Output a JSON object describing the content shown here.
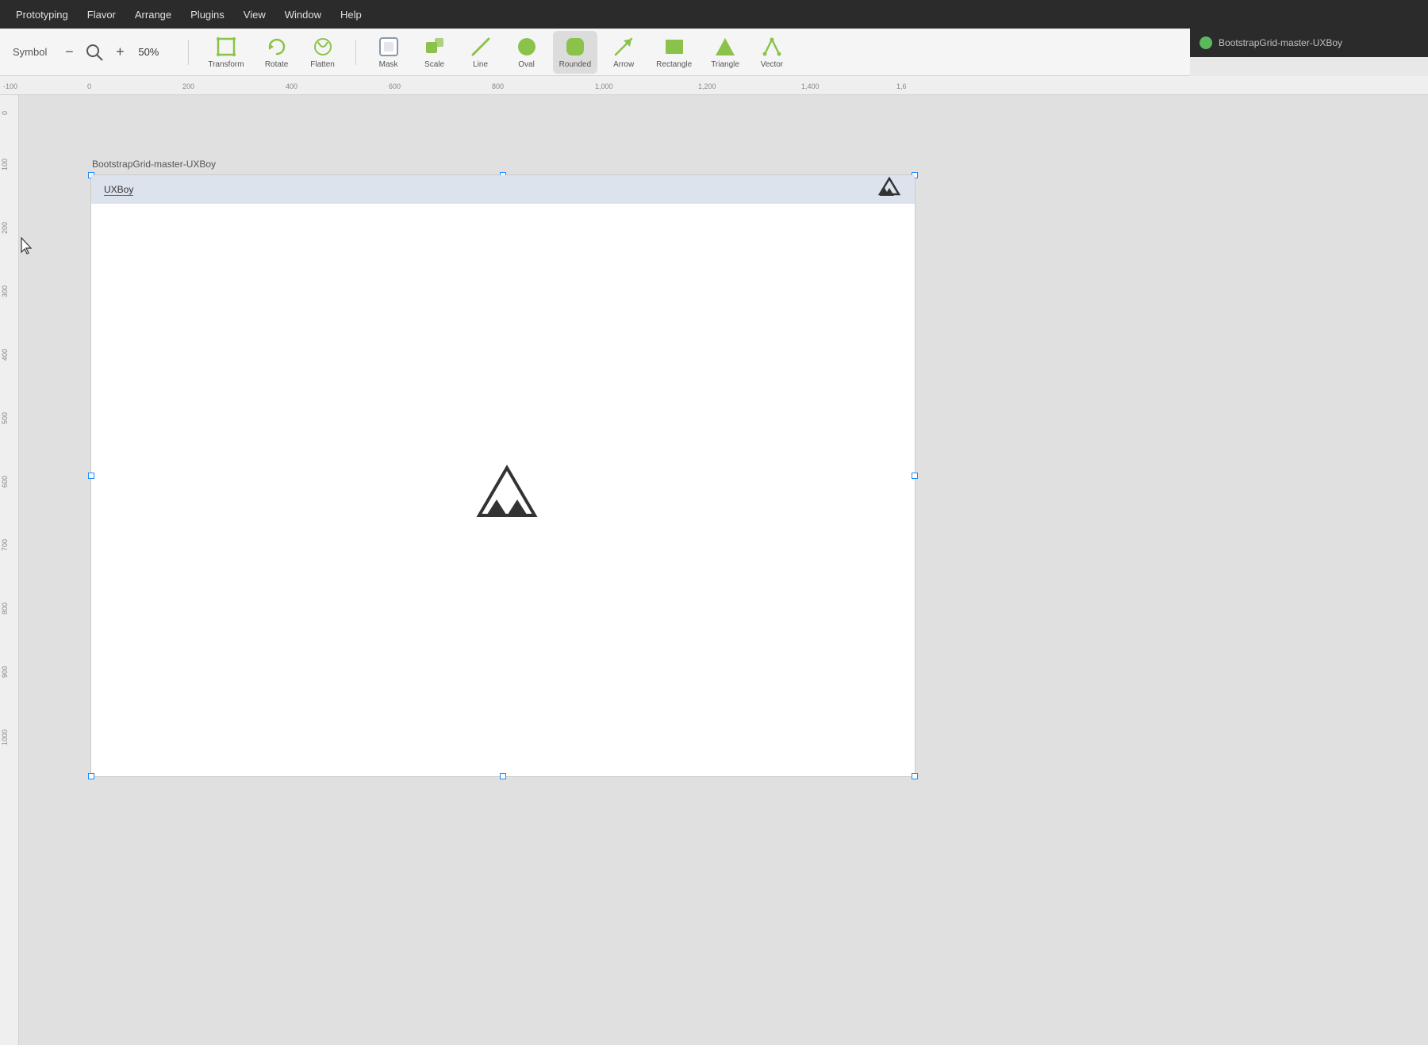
{
  "app": {
    "title": "BootstrapGrid-master-UXBoy",
    "file_icon_color": "#5cb85c"
  },
  "menu": {
    "items": [
      {
        "label": "Prototyping"
      },
      {
        "label": "Flavor"
      },
      {
        "label": "Arrange"
      },
      {
        "label": "Plugins"
      },
      {
        "label": "View"
      },
      {
        "label": "Window"
      },
      {
        "label": "Help"
      }
    ]
  },
  "toolbar": {
    "symbol_label": "Symbol",
    "zoom": {
      "minus": "−",
      "plus": "+",
      "level": "50%"
    },
    "tools": [
      {
        "id": "transform",
        "label": "Transform"
      },
      {
        "id": "rotate",
        "label": "Rotate"
      },
      {
        "id": "flatten",
        "label": "Flatten"
      },
      {
        "id": "mask",
        "label": "Mask"
      },
      {
        "id": "scale",
        "label": "Scale"
      },
      {
        "id": "line",
        "label": "Line"
      },
      {
        "id": "oval",
        "label": "Oval"
      },
      {
        "id": "rounded",
        "label": "Rounded"
      },
      {
        "id": "arrow",
        "label": "Arrow"
      },
      {
        "id": "rectangle",
        "label": "Rectangle"
      },
      {
        "id": "triangle",
        "label": "Triangle"
      },
      {
        "id": "vector",
        "label": "Vector"
      }
    ]
  },
  "ruler": {
    "h_marks": [
      "-100",
      "0",
      "200",
      "400",
      "600",
      "800",
      "1,000",
      "1,200",
      "1,400",
      "1,6"
    ],
    "v_marks": []
  },
  "canvas": {
    "artboard_label": "BootstrapGrid-master-UXBoy",
    "artboard_title": "UXBoy"
  }
}
